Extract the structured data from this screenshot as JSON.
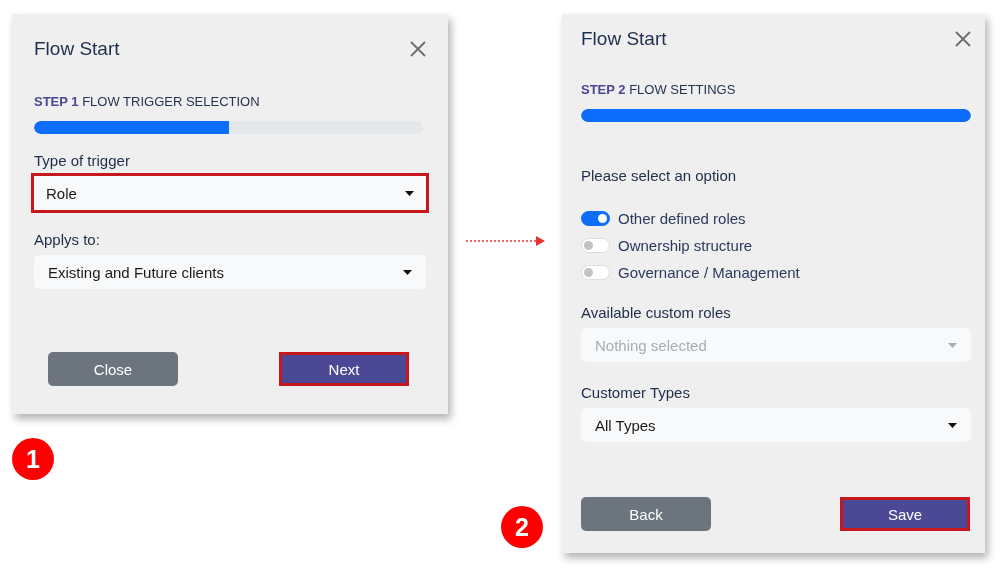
{
  "panels": [
    {
      "title": "Flow Start",
      "step": "**STEP 1** FLOW TRIGGER SELECTION",
      "progress": {
        "level": 0.5
      },
      "badge": "1",
      "fields": [
        {
          "kind": "select",
          "label": "Type of trigger",
          "value": "Role",
          "highlighted": true
        },
        {
          "kind": "select",
          "label": "Applys to:",
          "value": "Existing and Future clients",
          "highlighted": false
        }
      ],
      "buttons": [
        {
          "label": "Close",
          "kind": "secondary",
          "highlighted": false
        },
        {
          "label": "Next",
          "kind": "primary",
          "highlighted": true
        }
      ]
    },
    {
      "title": "Flow Start",
      "step": "**STEP 2** FLOW SETTINGS",
      "progress": {
        "level": 1
      },
      "badge": "2",
      "fields": [
        {
          "kind": "heading",
          "label": "Please select an option"
        },
        {
          "kind": "toggles",
          "items": [
            {
              "label": "Other defined roles",
              "on": true
            },
            {
              "label": "Ownership structure",
              "on": false
            },
            {
              "label": "Governance / Management",
              "on": false
            }
          ]
        },
        {
          "kind": "select",
          "label": "Available custom roles",
          "placeholder": "Nothing selected",
          "disabled": true,
          "highlighted": false
        },
        {
          "kind": "select",
          "label": "Customer Types",
          "value": "All Types",
          "highlighted": false
        }
      ],
      "buttons": [
        {
          "label": "Back",
          "kind": "secondary",
          "highlighted": false
        },
        {
          "label": "Save",
          "kind": "primary",
          "highlighted": true
        }
      ]
    }
  ]
}
